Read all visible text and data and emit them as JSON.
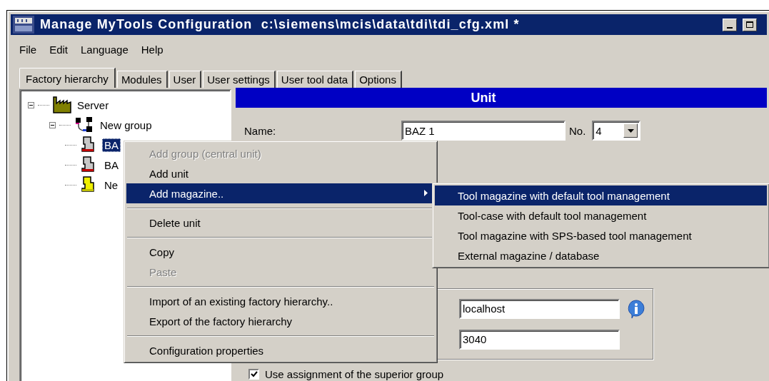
{
  "window": {
    "title": "Manage MyTools Configuration  c:\\siemens\\mcis\\data\\tdi\\tdi_cfg.xml *"
  },
  "menu_bar": [
    "File",
    "Edit",
    "Language",
    "Help"
  ],
  "tabs": [
    {
      "label": "Factory hierarchy",
      "selected": true
    },
    {
      "label": "Modules",
      "selected": false
    },
    {
      "label": "User",
      "selected": false
    },
    {
      "label": "User settings",
      "selected": false
    },
    {
      "label": "User tool data",
      "selected": false
    },
    {
      "label": "Options",
      "selected": false
    }
  ],
  "tree": {
    "items": [
      {
        "label": "Server",
        "kind": "factory",
        "expanded": true,
        "selected": false,
        "children": [
          {
            "label": "New group",
            "kind": "group",
            "expanded": true,
            "selected": false,
            "children": [
              {
                "label": "BA",
                "kind": "machine",
                "selected": true
              },
              {
                "label": "BA",
                "kind": "machine",
                "selected": false
              },
              {
                "label": "Ne",
                "kind": "new-machine",
                "selected": false
              }
            ]
          }
        ]
      }
    ]
  },
  "panel": {
    "title": "Unit",
    "name_label": "Name:",
    "name_value": "BAZ 1",
    "number_label": "No.",
    "number_value": "4",
    "host_value": "localhost",
    "port_value": "3040",
    "checkbox": {
      "label": "Use assignment of the superior group",
      "checked": true
    }
  },
  "context_menu": {
    "items": [
      {
        "kind": "item",
        "label": "Add group (central unit)",
        "disabled": true,
        "selected": false,
        "has_submenu": false
      },
      {
        "kind": "item",
        "label": "Add unit",
        "disabled": false,
        "selected": false,
        "has_submenu": false
      },
      {
        "kind": "item",
        "label": "Add magazine..",
        "disabled": false,
        "selected": true,
        "has_submenu": true
      },
      {
        "kind": "separator"
      },
      {
        "kind": "item",
        "label": "Delete unit",
        "disabled": false,
        "selected": false,
        "has_submenu": false
      },
      {
        "kind": "separator"
      },
      {
        "kind": "item",
        "label": "Copy",
        "disabled": false,
        "selected": false,
        "has_submenu": false
      },
      {
        "kind": "item",
        "label": "Paste",
        "disabled": true,
        "selected": false,
        "has_submenu": false
      },
      {
        "kind": "separator"
      },
      {
        "kind": "item",
        "label": "Import of an existing factory hierarchy..",
        "disabled": false,
        "selected": false,
        "has_submenu": false
      },
      {
        "kind": "item",
        "label": "Export of the factory hierarchy",
        "disabled": false,
        "selected": false,
        "has_submenu": false
      },
      {
        "kind": "separator"
      },
      {
        "kind": "item",
        "label": "Configuration properties",
        "disabled": false,
        "selected": false,
        "has_submenu": false
      }
    ]
  },
  "submenu": {
    "items": [
      {
        "label": "Tool magazine with default tool management",
        "selected": true
      },
      {
        "label": "Tool-case with default tool management",
        "selected": false
      },
      {
        "label": "Tool magazine with SPS-based tool management",
        "selected": false
      },
      {
        "label": "External magazine / database",
        "selected": false
      }
    ]
  }
}
